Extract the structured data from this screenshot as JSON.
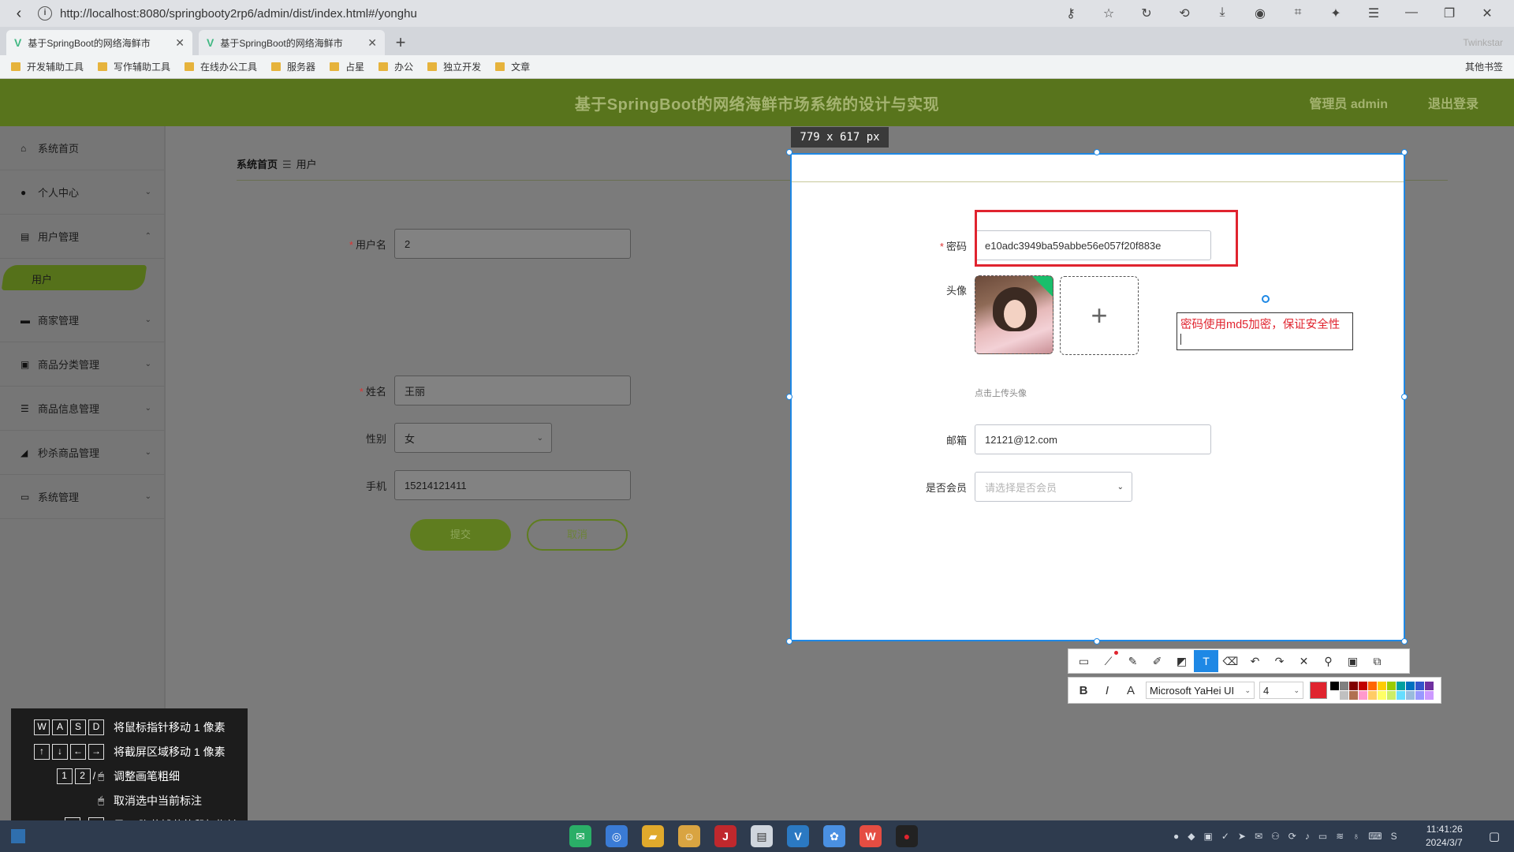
{
  "browser": {
    "url": "http://localhost:8080/springbooty2rp6/admin/dist/index.html#/yonghu",
    "tabs": [
      {
        "title": "基于SpringBoot的网络海鲜市"
      },
      {
        "title": "基于SpringBoot的网络海鲜市"
      }
    ],
    "right_profile": "Twinkstar",
    "bookmarks": [
      "开发辅助工具",
      "写作辅助工具",
      "在线办公工具",
      "服务器",
      "占星",
      "办公",
      "独立开发",
      "文章"
    ],
    "other_bookmarks": "其他书签"
  },
  "app": {
    "title": "基于SpringBoot的网络海鲜市场系统的设计与实现",
    "user": "管理员 admin",
    "logout": "退出登录",
    "colors": {
      "header": "#58741c",
      "accent": "#e0242f",
      "selection": "#1e88e5"
    }
  },
  "sidebar": {
    "items": [
      {
        "label": "系统首页",
        "icon": "home-icon"
      },
      {
        "label": "个人中心",
        "icon": "user-icon"
      },
      {
        "label": "用户管理",
        "icon": "clipboard-icon"
      },
      {
        "label": "商家管理",
        "icon": "chat-icon"
      },
      {
        "label": "商品分类管理",
        "icon": "list-icon"
      },
      {
        "label": "商品信息管理",
        "icon": "sliders-icon"
      },
      {
        "label": "秒杀商品管理",
        "icon": "megaphone-icon"
      },
      {
        "label": "系统管理",
        "icon": "monitor-icon"
      }
    ],
    "active_sub": "用户"
  },
  "breadcrumb": {
    "home": "系统首页",
    "sep": "☰",
    "current": "用户"
  },
  "form": {
    "username_label": "用户名",
    "username_value": "2",
    "password_label": "密码",
    "password_value": "e10adc3949ba59abbe56e057f20f883e",
    "avatar_label": "头像",
    "upload_hint": "点击上传头像",
    "name_label": "姓名",
    "name_value": "王丽",
    "gender_label": "性别",
    "gender_value": "女",
    "email_label": "邮箱",
    "email_value": "12121@12.com",
    "phone_label": "手机",
    "phone_value": "15214121411",
    "member_label": "是否会员",
    "member_placeholder": "请选择是否会员",
    "submit": "提交",
    "cancel": "取消"
  },
  "screenshot_tool": {
    "size_label": "779 x 617 px",
    "note_text": "密码使用md5加密，保证安全性",
    "font_name": "Microsoft YaHei UI",
    "font_size": "4",
    "palette": [
      "#000000",
      "#808080",
      "#800000",
      "#c00000",
      "#ff6600",
      "#ffcc00",
      "#99cc00",
      "#00a0a0",
      "#0070c0",
      "#3355cc",
      "#7030a0",
      "#ffffff",
      "#c0c0c0",
      "#b07050",
      "#ff99cc",
      "#ffcc66",
      "#ffff66",
      "#ccee66",
      "#66ddff",
      "#99bbdd",
      "#9999ff",
      "#cc99ff"
    ],
    "shortcuts": [
      {
        "keys": [
          "W",
          "A",
          "S",
          "D"
        ],
        "text": "将鼠标指针移动 1 像素"
      },
      {
        "keys": [
          "↑",
          "↓",
          "←",
          "→"
        ],
        "text": "将截屏区域移动 1 像素"
      },
      {
        "keys": [
          "1",
          "2",
          "/",
          "🖱"
        ],
        "text": "调整画笔粗细"
      },
      {
        "keys": [
          "🖱"
        ],
        "text": "取消选中当前标注"
      },
      {
        "keys": [
          "`",
          "/",
          "!"
        ],
        "text": "显示/隐藏捕获的鼠标指针"
      }
    ]
  },
  "taskbar": {
    "time": "11:41:26",
    "date": "2024/3/7"
  }
}
